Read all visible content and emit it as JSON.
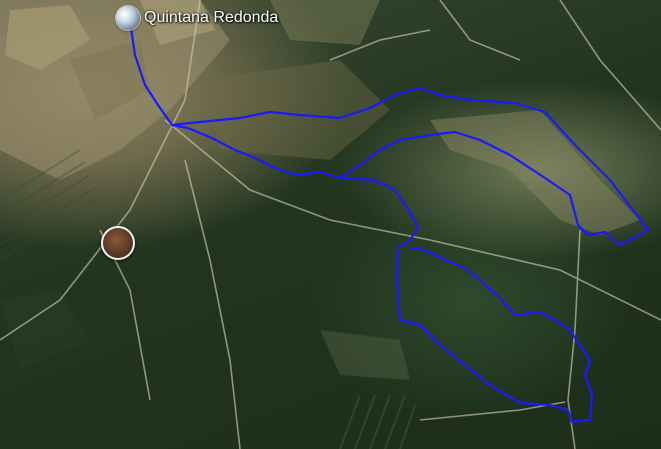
{
  "map": {
    "place_label": "Quintana Redonda",
    "place_icon": "globe-pin-icon",
    "photo_icon": "photo-thumbnail-icon",
    "route_color": "#1a1aff",
    "road_color": "#cfc8b4"
  }
}
